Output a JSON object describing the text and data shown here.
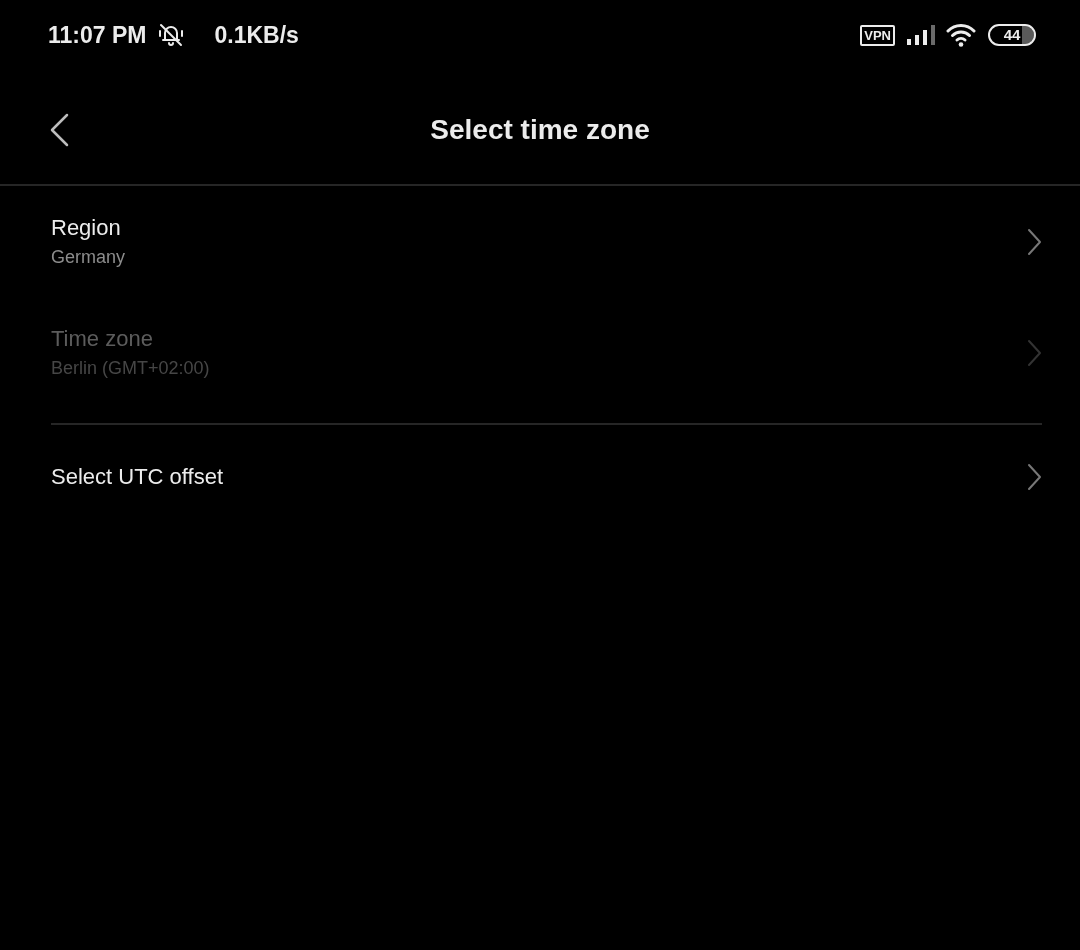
{
  "status_bar": {
    "time": "11:07 PM",
    "network_speed": "0.1KB/s",
    "vpn": "VPN",
    "battery": "44"
  },
  "header": {
    "title": "Select time zone"
  },
  "sections": [
    {
      "items": [
        {
          "title": "Region",
          "value": "Germany",
          "disabled": false
        },
        {
          "title": "Time zone",
          "value": "Berlin (GMT+02:00)",
          "disabled": true
        }
      ]
    },
    {
      "items": [
        {
          "title": "Select UTC offset",
          "disabled": false
        }
      ]
    }
  ]
}
